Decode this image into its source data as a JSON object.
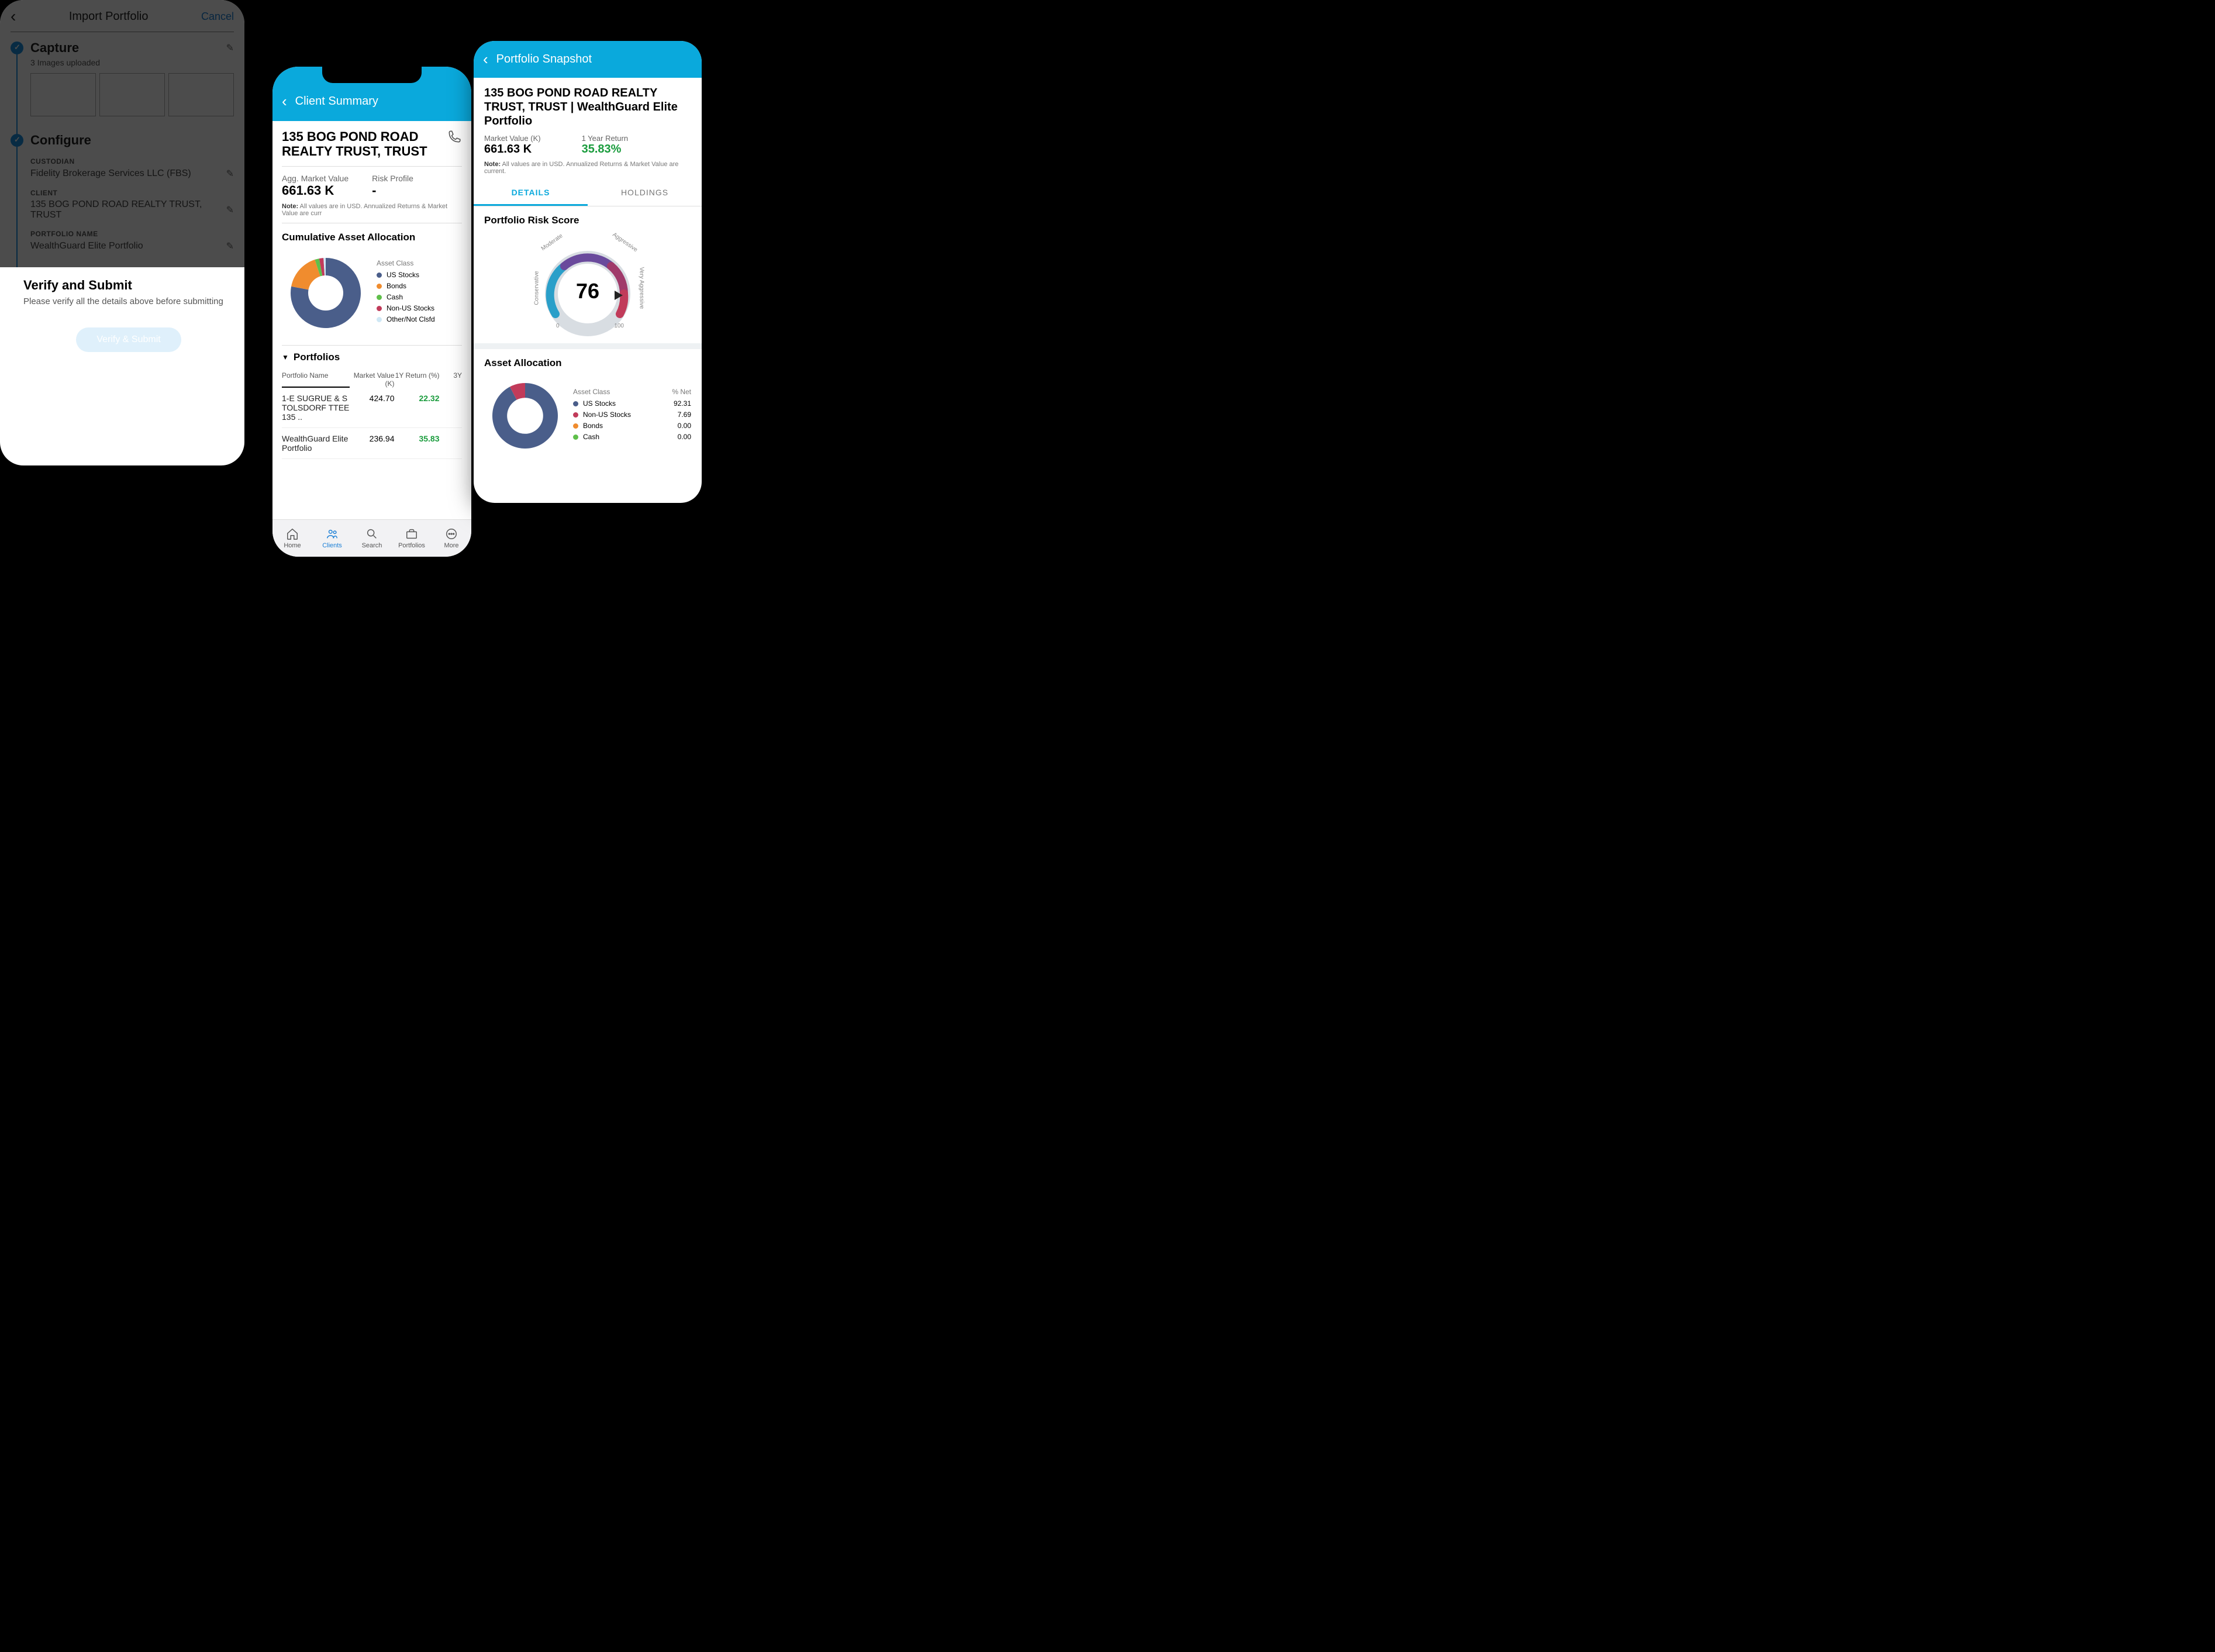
{
  "import": {
    "header": {
      "title": "Import Portfolio",
      "cancel": "Cancel"
    },
    "capture": {
      "title": "Capture",
      "sub": "3 Images uploaded"
    },
    "configure": {
      "title": "Configure",
      "custodian_label": "CUSTODIAN",
      "custodian_value": "Fidelity Brokerage Services LLC (FBS)",
      "client_label": "CLIENT",
      "client_value": "135 BOG POND ROAD REALTY TRUST, TRUST",
      "portfolio_label": "PORTFOLIO NAME",
      "portfolio_value": "WealthGuard Elite Portfolio"
    },
    "verify": {
      "title": "Verify and Submit",
      "sub": "Please verify all the details above before submitting",
      "button": "Verify & Submit"
    }
  },
  "client": {
    "header": "Client Summary",
    "title": "135 BOG POND ROAD REALTY TRUST, TRUST",
    "agg_label": "Agg. Market Value",
    "agg_value": "661.63 K",
    "risk_label": "Risk Profile",
    "risk_value": "-",
    "note_prefix": "Note:",
    "note_text": " All values are in USD. Annualized Returns & Market Value are curr",
    "cum_title": "Cumulative Asset Allocation",
    "legend_header": "Asset Class",
    "portfolios_title": "Portfolios",
    "col_name": "Portfolio Name",
    "col_mv": "Market Value (K)",
    "col_1y": "1Y Return (%)",
    "col_3y": "3Y",
    "rows": [
      {
        "name": "1-E SUGRUE & S TOLSDORF TTEE 135 ..",
        "mv": "424.70",
        "r1": "22.32"
      },
      {
        "name": "WealthGuard Elite Portfolio",
        "mv": "236.94",
        "r1": "35.83"
      }
    ],
    "nav": {
      "home": "Home",
      "clients": "Clients",
      "search": "Search",
      "portfolios": "Portfolios",
      "more": "More"
    }
  },
  "snapshot": {
    "header": "Portfolio Snapshot",
    "title": "135 BOG POND ROAD REALTY TRUST, TRUST | WealthGuard Elite Portfolio",
    "mv_label": "Market Value (K)",
    "mv_value": "661.63 K",
    "ret_label": "1 Year Return",
    "ret_value": "35.83%",
    "note_prefix": "Note:",
    "note_text": " All values are in USD. Annualized Returns & Market Value are current.",
    "tab_details": "DETAILS",
    "tab_holdings": "HOLDINGS",
    "risk_title": "Portfolio Risk Score",
    "risk_score": "76",
    "gauge": {
      "conservative": "Conservative",
      "moderate": "Moderate",
      "aggressive": "Aggressive",
      "very_aggressive": "Very Aggressive",
      "min": "0",
      "max": "100"
    },
    "alloc_title": "Asset Allocation",
    "alloc_head_class": "Asset Class",
    "alloc_head_pct": "% Net"
  },
  "chart_data": [
    {
      "type": "pie",
      "title": "Cumulative Asset Allocation",
      "series": [
        {
          "name": "US Stocks",
          "value": 78,
          "color": "#4a5e8a"
        },
        {
          "name": "Bonds",
          "value": 17,
          "color": "#f08c2e"
        },
        {
          "name": "Cash",
          "value": 2,
          "color": "#5fbf4a"
        },
        {
          "name": "Non-US Stocks",
          "value": 2,
          "color": "#c13b5a"
        },
        {
          "name": "Other/Not Clsfd",
          "value": 1,
          "color": "#cfe8f5"
        }
      ]
    },
    {
      "type": "gauge",
      "title": "Portfolio Risk Score",
      "value": 76,
      "range": [
        0,
        100
      ],
      "bands": [
        "Conservative",
        "Moderate",
        "Aggressive",
        "Very Aggressive"
      ]
    },
    {
      "type": "pie",
      "title": "Asset Allocation",
      "series": [
        {
          "name": "US Stocks",
          "value": 92.31,
          "color": "#4a5e8a"
        },
        {
          "name": "Non-US Stocks",
          "value": 7.69,
          "color": "#c13b5a"
        },
        {
          "name": "Bonds",
          "value": 0.0,
          "color": "#f08c2e"
        },
        {
          "name": "Cash",
          "value": 0.0,
          "color": "#5fbf4a"
        }
      ]
    }
  ]
}
